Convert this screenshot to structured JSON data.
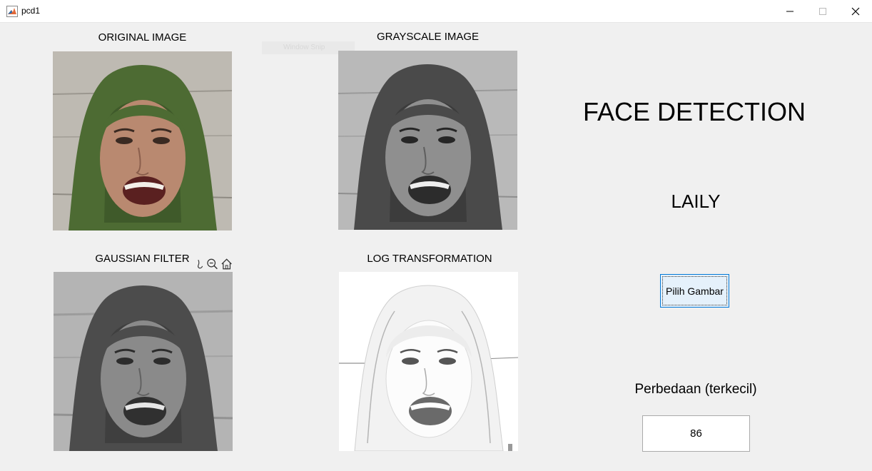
{
  "window": {
    "title": "pcd1",
    "controls": [
      "minimize",
      "maximize",
      "close"
    ]
  },
  "panels": {
    "original": {
      "title": "ORIGINAL IMAGE"
    },
    "grayscale": {
      "title": "GRAYSCALE IMAGE"
    },
    "gaussian": {
      "title": "GAUSSIAN FILTER"
    },
    "log": {
      "title": "LOG TRANSFORMATION"
    }
  },
  "axes_toolbar": {
    "icons": [
      "pan-icon",
      "zoom-out-icon",
      "home-icon"
    ]
  },
  "main": {
    "app_title": "FACE DETECTION",
    "name": "LAILY",
    "pick_button": "Pilih Gambar",
    "difference_label": "Perbedaan (terkecil)",
    "difference_value": "86"
  },
  "ghost_text": "Window Snip",
  "colors": {
    "background": "#f0f0f0",
    "hijab_green": "#4d6b33",
    "skin": "#b98970",
    "button_bg": "#e5f1fb",
    "button_border": "#0078d7"
  }
}
